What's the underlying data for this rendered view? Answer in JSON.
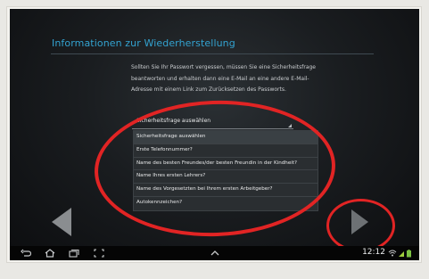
{
  "setup": {
    "title": "Informationen zur Wiederherstellung",
    "description": "Sollten Sie Ihr Passwort vergessen, müssen Sie eine Sicherheitsfrage beantworten und erhalten dann eine E-Mail an eine andere E-Mail-Adresse mit einem Link zum Zurücksetzen des Passworts.",
    "select_label": "Sicherheitsfrage auswählen",
    "options": [
      "Sicherheitsfrage auswählen",
      "Erste Telefonnummer?",
      "Name des besten Freundes/der besten Freundin in der Kindheit?",
      "Name Ihres ersten Lehrers?",
      "Name des Vorgesetzten bei Ihrem ersten Arbeitgeber?",
      "Autokennzeichen?"
    ]
  },
  "system_bar": {
    "time": "12:12",
    "icons": [
      "back-icon",
      "home-icon",
      "recent-apps-icon",
      "screenshot-icon",
      "chevron-up-icon",
      "wifi-icon",
      "signal-icon",
      "battery-icon"
    ]
  },
  "colors": {
    "accent": "#33a3d1",
    "annotation": "#e12424"
  }
}
